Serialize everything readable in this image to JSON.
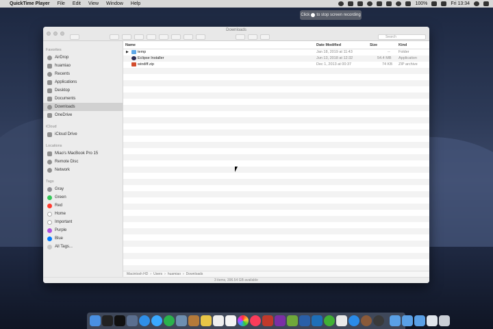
{
  "menubar": {
    "apple": "",
    "app": "QuickTime Player",
    "items": [
      "File",
      "Edit",
      "View",
      "Window",
      "Help"
    ],
    "battery": "100%",
    "clock": "Fri 13:34"
  },
  "tooltip": {
    "pre": "Click",
    "post": "to stop screen recording"
  },
  "finder": {
    "title": "Downloads",
    "search_placeholder": "Search",
    "sidebar": {
      "favorites_header": "Favorites",
      "favorites": [
        "AirDrop",
        "huamiao",
        "Recents",
        "Applications",
        "Desktop",
        "Documents",
        "Downloads",
        "OneDrive"
      ],
      "icloud_header": "iCloud",
      "icloud": [
        "iCloud Drive"
      ],
      "locations_header": "Locations",
      "locations": [
        "Miao's MacBook Pro 15",
        "Remote Disc",
        "Network"
      ],
      "tags_header": "Tags",
      "tags": [
        {
          "name": "Gray",
          "color": "#8e8e93"
        },
        {
          "name": "Green",
          "color": "#34c759"
        },
        {
          "name": "Red",
          "color": "#ff3b30"
        },
        {
          "name": "Home",
          "color": "#ffffff"
        },
        {
          "name": "Important",
          "color": "#ffffff"
        },
        {
          "name": "Purple",
          "color": "#af52de"
        },
        {
          "name": "Blue",
          "color": "#007aff"
        },
        {
          "name": "All Tags...",
          "color": "#c7c7c7"
        }
      ]
    },
    "columns": {
      "name": "Name",
      "date": "Date Modified",
      "size": "Size",
      "kind": "Kind"
    },
    "files": [
      {
        "name": "temp",
        "date": "Jan 18, 2019 at 11:43",
        "size": "--",
        "kind": "Folder",
        "icon": "folder-icon"
      },
      {
        "name": "Eclipse Installer",
        "date": "Jun 13, 2018 at 12:32",
        "size": "54.4 MB",
        "kind": "Application",
        "icon": "app-icon"
      },
      {
        "name": "windiff.zip",
        "date": "Dec 1, 2013 at 00:37",
        "size": "74 KB",
        "kind": "ZIP archive",
        "icon": "zip-icon"
      }
    ],
    "path": [
      "Macintosh HD",
      "Users",
      "huamiao",
      "Downloads"
    ],
    "status": "3 items, 396.54 GB available"
  }
}
